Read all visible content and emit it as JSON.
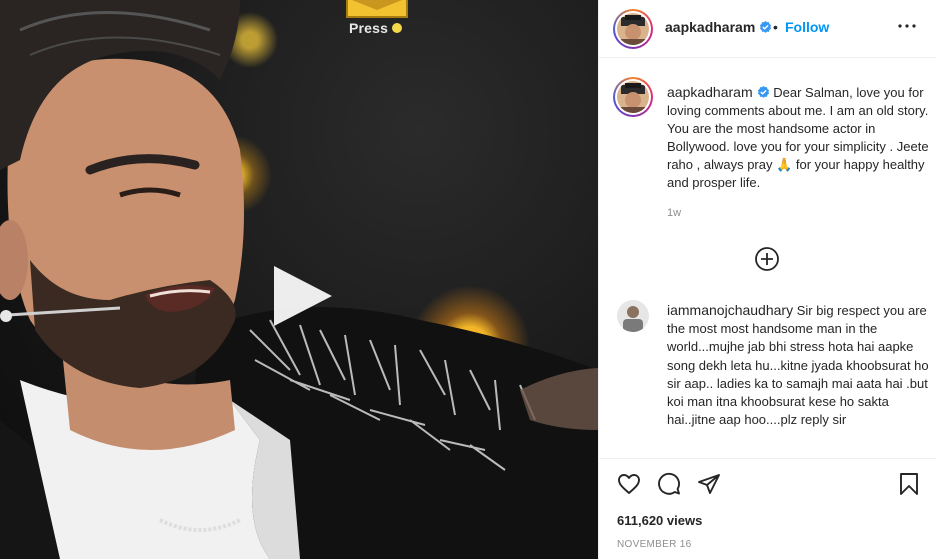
{
  "media": {
    "press_label": "Press"
  },
  "post": {
    "username": "aapkadharam",
    "follow_label": "Follow",
    "separator": "•"
  },
  "caption": {
    "username": "aapkadharam",
    "text": "Dear Salman, love you for loving comments about me. I am an old story. You are the most handsome actor in Bollywood. love you for your simplicity . Jeete raho , always pray 🙏 for your happy healthy and prosper life.",
    "time": "1w"
  },
  "comment": {
    "username": "iammanojchaudhary",
    "text": "Sir big respect you are the most most handsome man in the world...mujhe jab bhi stress hota hai aapke song dekh leta hu...kitne jyada khoobsurat ho sir aap.. ladies ka to samajh mai aata hai .but koi man itna khoobsurat kese ho sakta hai..jitne aap hoo....plz reply sir"
  },
  "stats": {
    "views": "611,620 views",
    "date": "NOVEMBER 16"
  },
  "icons": {
    "verified": "verified-badge-icon",
    "more": "more-options-icon",
    "load_more": "plus-circle-icon",
    "like": "heart-icon",
    "comment": "comment-icon",
    "share": "paper-plane-icon",
    "save": "bookmark-icon",
    "play": "play-icon"
  },
  "colors": {
    "accent": "#0095f6",
    "text": "#262626",
    "muted": "#8e8e8e",
    "verified": "#3897f0"
  }
}
